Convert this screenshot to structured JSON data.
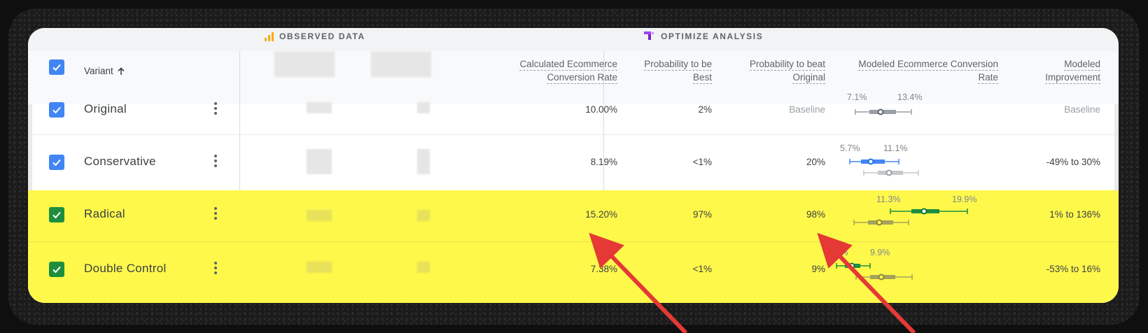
{
  "sections": {
    "observed": "OBSERVED DATA",
    "optimize": "OPTIMIZE ANALYSIS"
  },
  "header": {
    "variant": "Variant",
    "sort_icon": "arrow-up-icon",
    "calc_rate_line1": "Calculated Ecommerce",
    "calc_rate_line2": "Conversion Rate",
    "prob_best_line1": "Probability to be",
    "prob_best_line2": "Best",
    "prob_beat_line1": "Probability to beat",
    "prob_beat_line2": "Original",
    "modeled_rate_line1": "Modeled Ecommerce Conversion",
    "modeled_rate_line2": "Rate",
    "modeled_impr_line1": "Modeled",
    "modeled_impr_line2": "Improvement"
  },
  "rows": [
    {
      "name": "Original",
      "calc_rate": "10.00%",
      "prob_best": "2%",
      "prob_beat": "Baseline",
      "ci_low": "7.1%",
      "ci_high": "13.4%",
      "improvement": "Baseline"
    },
    {
      "name": "Conservative",
      "calc_rate": "8.19%",
      "prob_best": "<1%",
      "prob_beat": "20%",
      "ci_low": "5.7%",
      "ci_high": "11.1%",
      "improvement": "-49% to 30%"
    },
    {
      "name": "Radical",
      "calc_rate": "15.20%",
      "prob_best": "97%",
      "prob_beat": "98%",
      "ci_low": "11.3%",
      "ci_high": "19.9%",
      "improvement": "1% to 136%"
    },
    {
      "name": "Double Control",
      "calc_rate": "7.38%",
      "prob_best": "<1%",
      "prob_beat": "9%",
      "ci_low": "5.2%",
      "ci_high": "9.9%",
      "improvement": "-53% to 16%"
    }
  ],
  "colors": {
    "checkbox_blue": "#4285f4",
    "checkbox_green": "#1e8e3e",
    "highlight": "#fef84b",
    "arrow": "#e53935",
    "ci_gray": "#9aa0a6",
    "ci_blue": "#4285f4",
    "ci_green": "#1e8e3e"
  }
}
